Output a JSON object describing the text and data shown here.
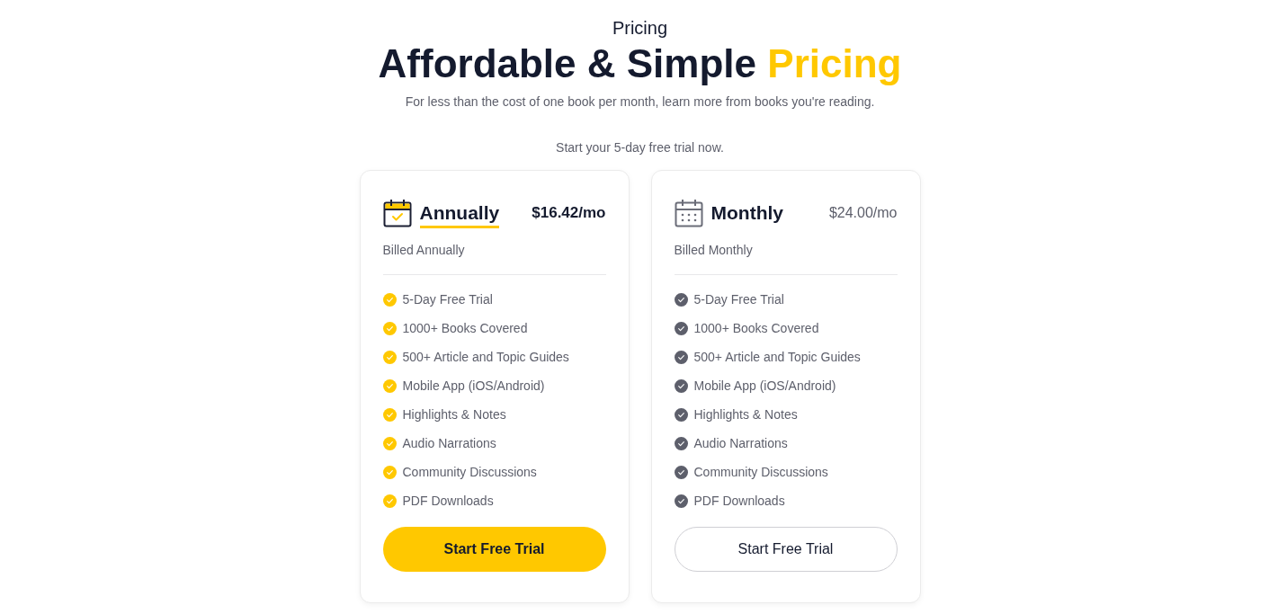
{
  "header": {
    "eyebrow": "Pricing",
    "title": [
      {
        "text": "Affordable & Simple",
        "highlight": false
      },
      {
        "text": "Pricing",
        "highlight": true
      }
    ],
    "subtitle": "For less than the cost of one book per month, learn more from books you're reading.",
    "trial_note": "Start your 5-day free trial now."
  },
  "plans": [
    {
      "name": "Annually",
      "price": "$16.42/mo",
      "billing": "Billed Annually",
      "selected": true,
      "features": [
        "5-Day Free Trial",
        "1000+ Books Covered",
        "500+ Article and Topic Guides",
        "Mobile App (iOS/Android)",
        "Highlights & Notes",
        "Audio Narrations",
        "Community Discussions",
        "PDF Downloads"
      ],
      "button": "Start Free Trial"
    },
    {
      "name": "Monthly",
      "price": "$24.00/mo",
      "billing": "Billed Monthly",
      "selected": false,
      "features": [
        "5-Day Free Trial",
        "1000+ Books Covered",
        "500+ Article and Topic Guides",
        "Mobile App (iOS/Android)",
        "Highlights & Notes",
        "Audio Narrations",
        "Community Discussions",
        "PDF Downloads"
      ],
      "button": "Start Free Trial"
    }
  ]
}
